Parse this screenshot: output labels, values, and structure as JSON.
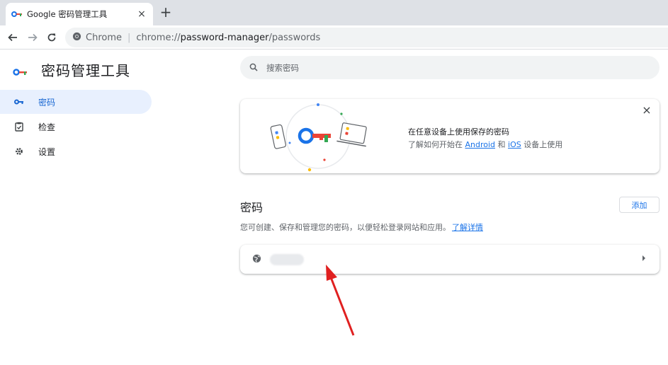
{
  "browser": {
    "tab_title": "Google 密码管理工具",
    "tab_close": "×",
    "new_tab": "+",
    "omnibox": {
      "site_chip": "Chrome",
      "separator": "|",
      "scheme": "chrome://",
      "host": "password-manager",
      "path": "/passwords"
    }
  },
  "app": {
    "title": "密码管理工具"
  },
  "sidebar": {
    "items": [
      {
        "label": "密码",
        "icon": "key-icon",
        "active": true
      },
      {
        "label": "检查",
        "icon": "clipboard-check-icon",
        "active": false
      },
      {
        "label": "设置",
        "icon": "gear-icon",
        "active": false
      }
    ]
  },
  "search": {
    "placeholder": "搜索密码"
  },
  "promo": {
    "line1": "在任意设备上使用保存的密码",
    "line2_prefix": "了解如何开始在 ",
    "link_android": "Android",
    "line2_mid": " 和 ",
    "link_ios": "iOS",
    "line2_suffix": " 设备上使用",
    "close": "×"
  },
  "passwords": {
    "title": "密码",
    "add_label": "添加",
    "description": "您可创建、保存和管理您的密码，以便轻松登录网站和应用。",
    "learn_more": "了解详情"
  },
  "colors": {
    "accent": "#1a73e8",
    "active_nav_bg": "#e8f0fe",
    "annotation_arrow": "#e02020"
  }
}
